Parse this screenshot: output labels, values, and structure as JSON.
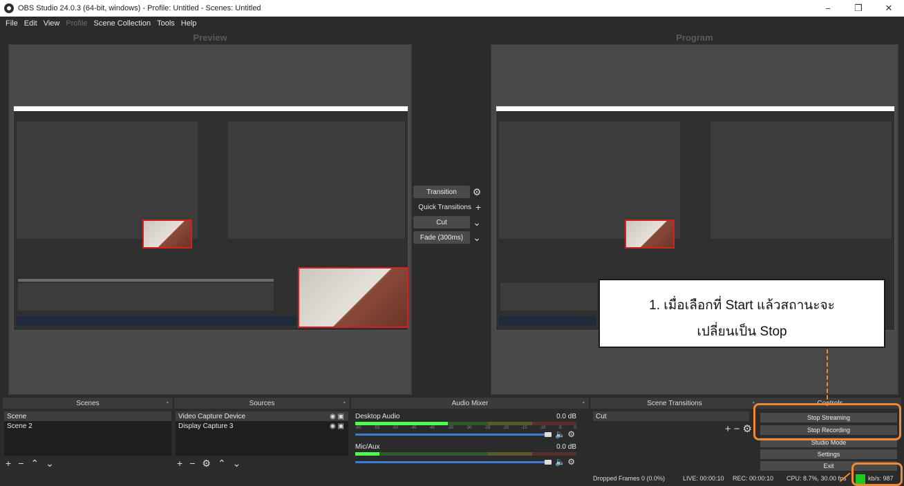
{
  "window": {
    "title": "OBS Studio 24.0.3 (64-bit, windows) - Profile: Untitled - Scenes: Untitled",
    "minimize_glyph": "−",
    "maximize_glyph": "❐",
    "close_glyph": "✕"
  },
  "menu": [
    "File",
    "Edit",
    "View",
    "Profile",
    "Scene Collection",
    "Tools",
    "Help"
  ],
  "preview_label": "Preview",
  "program_label": "Program",
  "transitions": {
    "transition_label": "Transition",
    "quick_transitions_label": "Quick Transitions",
    "cut_label": "Cut",
    "fade_label": "Fade (300ms)"
  },
  "docks": {
    "scenes": {
      "title": "Scenes",
      "items": [
        "Scene",
        "Scene 2"
      ]
    },
    "sources": {
      "title": "Sources",
      "items": [
        "Video Capture Device",
        "Display Capture 3"
      ]
    },
    "audio_mixer": {
      "title": "Audio Mixer",
      "channels": [
        {
          "name": "Desktop Audio",
          "db": "0.0 dB",
          "level": 0.42
        },
        {
          "name": "Mic/Aux",
          "db": "0.0 dB",
          "level": 0.11
        }
      ],
      "ticks": [
        "-60",
        "-55",
        "-50",
        "-45",
        "-40",
        "-35",
        "-30",
        "-25",
        "-20",
        "-15",
        "-10",
        "-5",
        "0"
      ]
    },
    "scene_transitions": {
      "title": "Scene Transitions",
      "selected": "Cut"
    },
    "controls": {
      "title": "Controls",
      "stop_streaming": "Stop Streaming",
      "stop_recording": "Stop Recording",
      "studio_mode": "Studio Mode",
      "settings": "Settings",
      "exit": "Exit"
    }
  },
  "status": {
    "dropped_frames": "Dropped Frames 0 (0.0%)",
    "live": "LIVE: 00:00:10",
    "rec": "REC: 00:00:10",
    "cpu": "CPU: 8.7%, 30.00 fps",
    "kbps": "kb/s: 987"
  },
  "callout": {
    "line1": "1. เมื่อเลือกที่ Start แล้วสถานะจะ",
    "line2": "เปลี่ยนเป็น Stop"
  },
  "colors": {
    "annotation_orange": "#f08a32",
    "status_green": "#1ec91e",
    "source_highlight_red": "#d62020"
  }
}
